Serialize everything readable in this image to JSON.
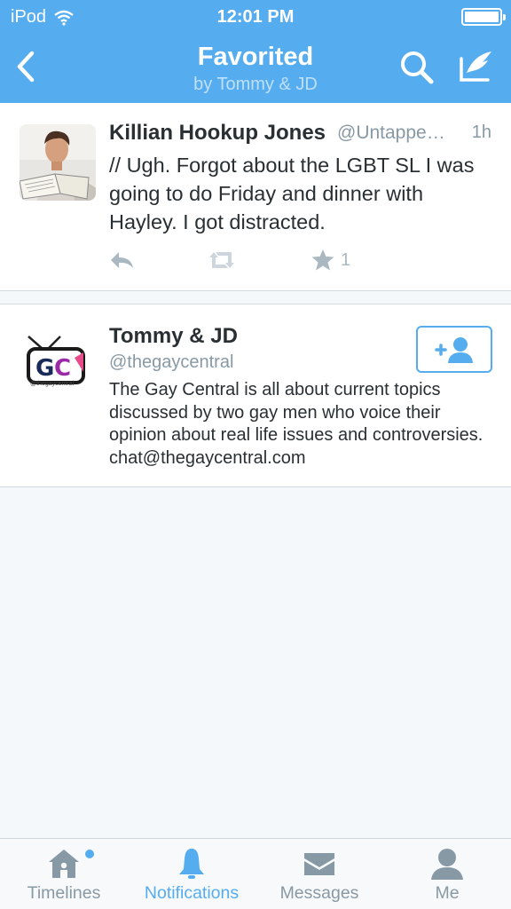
{
  "status_bar": {
    "carrier": "iPod",
    "time": "12:01 PM"
  },
  "nav": {
    "title": "Favorited",
    "subtitle": "by Tommy & JD"
  },
  "tweet": {
    "author_name": "Killian Hookup Jones",
    "author_handle": "@Untappe…",
    "age": "1h",
    "text": "// Ugh. Forgot about the LGBT SL I was going to do Friday and dinner with Hayley. I got distracted.",
    "favorite_count": "1"
  },
  "account": {
    "name": "Tommy & JD",
    "handle": "@thegaycentral",
    "bio": "The Gay Central is all about current topics discussed by two gay men who voice their opinion about real life issues and controversies. chat@thegaycentral.com",
    "logo_text": "@thegaycentral"
  },
  "tabs": [
    {
      "label": "Timelines",
      "icon": "home-icon"
    },
    {
      "label": "Notifications",
      "icon": "bell-icon"
    },
    {
      "label": "Messages",
      "icon": "envelope-icon"
    },
    {
      "label": "Me",
      "icon": "person-icon"
    }
  ],
  "colors": {
    "accent": "#55acee",
    "muted": "#8899a6",
    "background": "#f5f8fa"
  }
}
